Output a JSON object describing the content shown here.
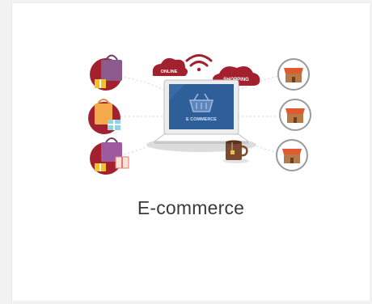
{
  "card": {
    "title": "E-commerce",
    "illustration": {
      "cloud_left_label": "ONLINE",
      "cloud_right_label": "SHOPPING",
      "screen_label": "E COMMERCE",
      "icons": [
        "shopping-bag-icon",
        "gift-box-icon",
        "wifi-icon",
        "laptop-icon",
        "basket-icon",
        "coffee-mug-icon",
        "store-icon"
      ]
    }
  },
  "colors": {
    "accent": "#a3202f",
    "screen": "#2e5f99",
    "background": "#f2f2f2"
  }
}
